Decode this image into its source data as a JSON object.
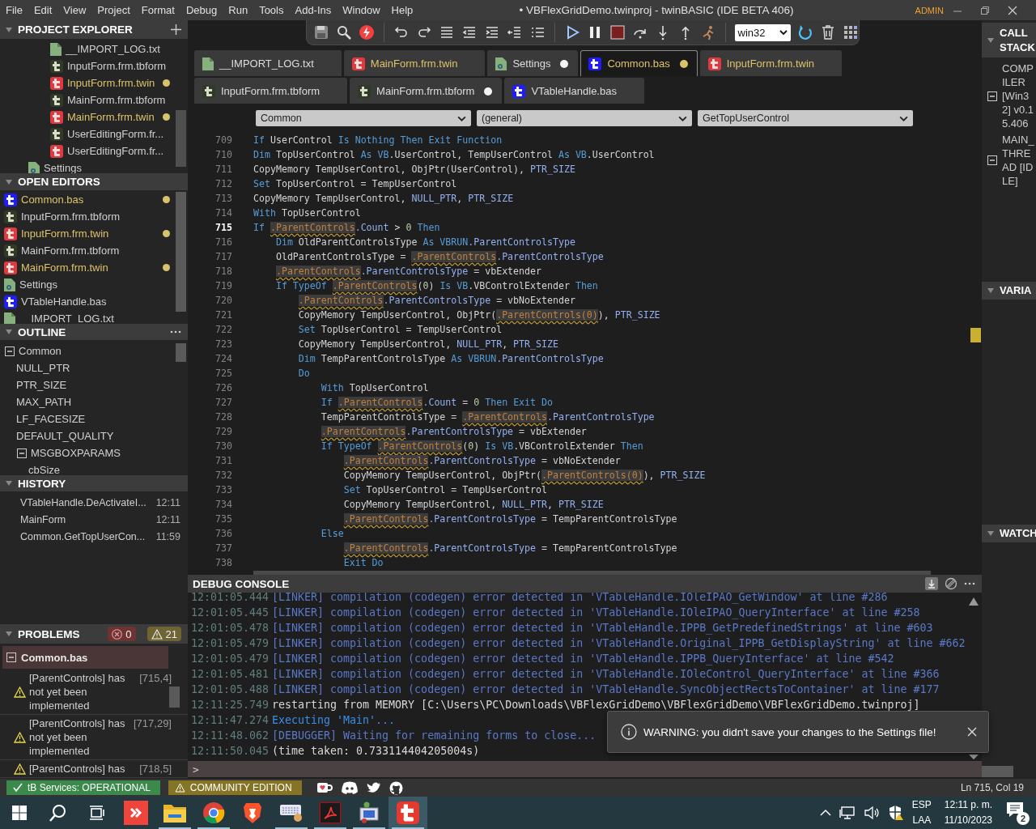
{
  "title_bar": {
    "menus": [
      "File",
      "Edit",
      "View",
      "Project",
      "Format",
      "Debug",
      "Run",
      "Tools",
      "Add-Ins",
      "Window",
      "Help"
    ],
    "title": "• VBFlexGridDemo.twinproj - twinBASIC (IDE BETA 406)",
    "user": "ADMIN"
  },
  "project_explorer": {
    "title": "PROJECT EXPLORER",
    "items": [
      {
        "kind": "group",
        "children": [
          {
            "kind": "txt",
            "label": "__IMPORT_LOG.txt",
            "warning": false,
            "unsaved": false
          },
          {
            "kind": "tbform",
            "label": "InputForm.frm.tbform",
            "warning": false,
            "unsaved": false
          },
          {
            "kind": "twin",
            "label": "InputForm.frm.twin",
            "warning": true,
            "unsaved": true
          },
          {
            "kind": "tbform",
            "label": "MainForm.frm.tbform",
            "warning": false,
            "unsaved": false
          },
          {
            "kind": "twin",
            "label": "MainForm.frm.twin",
            "warning": true,
            "unsaved": true
          },
          {
            "kind": "tbform",
            "label": "UserEditingForm.fr...",
            "warning": false,
            "unsaved": false
          },
          {
            "kind": "twin",
            "label": "UserEditingForm.fr...",
            "warning": false,
            "unsaved": false
          }
        ]
      },
      {
        "kind": "settings",
        "label": "Settings",
        "warning": false,
        "unsaved": false
      }
    ]
  },
  "open_editors": {
    "title": "OPEN EDITORS",
    "items": [
      {
        "kind": "bas",
        "label": "Common.bas",
        "warning": true,
        "unsaved": true
      },
      {
        "kind": "tbform",
        "label": "InputForm.frm.tbform",
        "warning": false,
        "unsaved": false
      },
      {
        "kind": "twin",
        "label": "InputForm.frm.twin",
        "warning": true,
        "unsaved": true
      },
      {
        "kind": "tbform",
        "label": "MainForm.frm.tbform",
        "warning": false,
        "unsaved": false
      },
      {
        "kind": "twin",
        "label": "MainForm.frm.twin",
        "warning": true,
        "unsaved": true
      },
      {
        "kind": "settings",
        "label": "Settings",
        "warning": false,
        "unsaved": false
      },
      {
        "kind": "bas",
        "label": "VTableHandle.bas",
        "warning": false,
        "unsaved": false
      },
      {
        "kind": "txt",
        "label": "__IMPORT_LOG.txt",
        "warning": false,
        "unsaved": false
      }
    ]
  },
  "outline": {
    "title": "OUTLINE",
    "items": [
      {
        "label": "Common",
        "expanded": true,
        "children": [
          {
            "label": "NULL_PTR"
          },
          {
            "label": "PTR_SIZE"
          },
          {
            "label": "MAX_PATH"
          },
          {
            "label": "LF_FACESIZE"
          },
          {
            "label": "DEFAULT_QUALITY"
          },
          {
            "label": "MSGBOXPARAMS",
            "expanded": true,
            "children": [
              {
                "label": "cbSize"
              }
            ]
          }
        ]
      }
    ]
  },
  "history": {
    "title": "HISTORY",
    "items": [
      {
        "label": "VTableHandle.DeActivateI...",
        "time": "12:11"
      },
      {
        "label": "MainForm",
        "time": "12:11"
      },
      {
        "label": "Common.GetTopUserCon...",
        "time": "11:59"
      }
    ]
  },
  "problems": {
    "title": "PROBLEMS",
    "errors": "0",
    "warnings": "21",
    "groups": [
      {
        "file": "Common.bas",
        "expanded": true,
        "selected": true,
        "items": [
          {
            "message": "[ParentControls] has not yet been implemented",
            "location": "[715,4]"
          },
          {
            "message": "[ParentControls] has not yet been implemented",
            "location": "[717,29]"
          },
          {
            "message": "[ParentControls] has",
            "location": "[718,5]"
          }
        ]
      }
    ]
  },
  "toolbar": {
    "platform": "win32"
  },
  "tab_rows": [
    {
      "tabs": [
        {
          "kind": "txt",
          "label": "__IMPORT_LOG.txt",
          "warning": false,
          "unsaved": false,
          "selected": false
        },
        {
          "kind": "twin",
          "label": "MainForm.frm.twin",
          "warning": true,
          "unsaved": false,
          "selected": false
        },
        {
          "kind": "settings",
          "label": "Settings",
          "warning": false,
          "unsaved": true,
          "selected": false
        },
        {
          "kind": "bas",
          "label": "Common.bas",
          "warning": true,
          "unsaved": true,
          "selected": true
        },
        {
          "kind": "twin",
          "label": "InputForm.frm.twin",
          "warning": true,
          "unsaved": false,
          "selected": false
        }
      ]
    },
    {
      "tabs": [
        {
          "kind": "tbform",
          "label": "InputForm.frm.tbform",
          "warning": false,
          "unsaved": false,
          "selected": false
        },
        {
          "kind": "tbform",
          "label": "MainForm.frm.tbform",
          "warning": false,
          "unsaved": true,
          "selected": false
        },
        {
          "kind": "bas",
          "label": "VTableHandle.bas",
          "warning": false,
          "unsaved": false,
          "selected": false
        }
      ]
    }
  ],
  "code_nav": [
    {
      "value": "Common"
    },
    {
      "value": "(general)"
    },
    {
      "value": "GetTopUserControl"
    }
  ],
  "editor": {
    "lines": [
      {
        "number": "709",
        "current": false,
        "tokens": [
          {
            "kind": "kw",
            "text": "If "
          },
          {
            "kind": "id",
            "text": "UserControl "
          },
          {
            "kind": "kw",
            "text": "Is Nothing Then Exit Function"
          }
        ]
      },
      {
        "number": "710",
        "current": false,
        "tokens": [
          {
            "kind": "kw",
            "text": "Dim "
          },
          {
            "kind": "id",
            "text": "TopUserControl "
          },
          {
            "kind": "kw",
            "text": "As VB"
          },
          {
            "kind": "id",
            "text": ".UserControl, TempUserControl "
          },
          {
            "kind": "kw",
            "text": "As VB"
          },
          {
            "kind": "id",
            "text": ".UserControl"
          }
        ]
      },
      {
        "number": "711",
        "current": false,
        "tokens": [
          {
            "kind": "id",
            "text": "CopyMemory TempUserControl, ObjPtr(UserControl), "
          },
          {
            "kind": "prop",
            "text": "PTR_SIZE"
          }
        ]
      },
      {
        "number": "712",
        "current": false,
        "tokens": [
          {
            "kind": "kw",
            "text": "Set "
          },
          {
            "kind": "id",
            "text": "TopUserControl = TempUserControl"
          }
        ]
      },
      {
        "number": "713",
        "current": false,
        "tokens": [
          {
            "kind": "id",
            "text": "CopyMemory TempUserControl, "
          },
          {
            "kind": "prop",
            "text": "NULL_PTR"
          },
          {
            "kind": "id",
            "text": ", "
          },
          {
            "kind": "prop",
            "text": "PTR_SIZE"
          }
        ]
      },
      {
        "number": "714",
        "current": false,
        "tokens": [
          {
            "kind": "kw",
            "text": "With "
          },
          {
            "kind": "id",
            "text": "TopUserControl"
          }
        ]
      },
      {
        "number": "715",
        "current": true,
        "tokens": [
          {
            "kind": "kw",
            "text": "If "
          },
          {
            "kind": "warn",
            "text": ".ParentControls"
          },
          {
            "kind": "prop",
            "text": ".Count"
          },
          {
            "kind": "id",
            "text": " > "
          },
          {
            "kind": "num",
            "text": "0"
          },
          {
            "kind": "kw",
            "text": " Then"
          }
        ]
      },
      {
        "number": "716",
        "current": false,
        "tokens": [
          {
            "kind": "kw",
            "text": "    Dim "
          },
          {
            "kind": "id",
            "text": "OldParentControlsType "
          },
          {
            "kind": "kw",
            "text": "As VBRUN"
          },
          {
            "kind": "prop",
            "text": ".ParentControlsType"
          }
        ]
      },
      {
        "number": "717",
        "current": false,
        "tokens": [
          {
            "kind": "id",
            "text": "    OldParentControlsType = "
          },
          {
            "kind": "warn",
            "text": ".ParentControls"
          },
          {
            "kind": "prop",
            "text": ".ParentControlsType"
          }
        ]
      },
      {
        "number": "718",
        "current": false,
        "tokens": [
          {
            "kind": "warn",
            "text": "    .ParentControls"
          },
          {
            "kind": "prop",
            "text": ".ParentControlsType"
          },
          {
            "kind": "id",
            "text": " = vbExtender"
          }
        ]
      },
      {
        "number": "719",
        "current": false,
        "tokens": [
          {
            "kind": "kw",
            "text": "    If TypeOf "
          },
          {
            "kind": "warn",
            "text": ".ParentControls"
          },
          {
            "kind": "id",
            "text": "("
          },
          {
            "kind": "num",
            "text": "0"
          },
          {
            "kind": "id",
            "text": ") "
          },
          {
            "kind": "kw",
            "text": "Is VB"
          },
          {
            "kind": "id",
            "text": ".VBControlExtender "
          },
          {
            "kind": "kw",
            "text": "Then"
          }
        ]
      },
      {
        "number": "720",
        "current": false,
        "tokens": [
          {
            "kind": "warn",
            "text": "        .ParentControls"
          },
          {
            "kind": "prop",
            "text": ".ParentControlsType"
          },
          {
            "kind": "id",
            "text": " = vbNoExtender"
          }
        ]
      },
      {
        "number": "721",
        "current": false,
        "tokens": [
          {
            "kind": "id",
            "text": "        CopyMemory TempUserControl, ObjPtr("
          },
          {
            "kind": "warn",
            "text": ".ParentControls(0)"
          },
          {
            "kind": "id",
            "text": "), "
          },
          {
            "kind": "prop",
            "text": "PTR_SIZE"
          }
        ]
      },
      {
        "number": "722",
        "current": false,
        "tokens": [
          {
            "kind": "kw",
            "text": "        Set "
          },
          {
            "kind": "id",
            "text": "TopUserControl = TempUserControl"
          }
        ]
      },
      {
        "number": "723",
        "current": false,
        "tokens": [
          {
            "kind": "id",
            "text": "        CopyMemory TempUserControl, "
          },
          {
            "kind": "prop",
            "text": "NULL_PTR"
          },
          {
            "kind": "id",
            "text": ", "
          },
          {
            "kind": "prop",
            "text": "PTR_SIZE"
          }
        ]
      },
      {
        "number": "724",
        "current": false,
        "tokens": [
          {
            "kind": "kw",
            "text": "        Dim "
          },
          {
            "kind": "id",
            "text": "TempParentControlsType "
          },
          {
            "kind": "kw",
            "text": "As VBRUN"
          },
          {
            "kind": "prop",
            "text": ".ParentControlsType"
          }
        ]
      },
      {
        "number": "725",
        "current": false,
        "tokens": [
          {
            "kind": "kw",
            "text": "        Do"
          }
        ]
      },
      {
        "number": "726",
        "current": false,
        "tokens": [
          {
            "kind": "kw",
            "text": "            With "
          },
          {
            "kind": "id",
            "text": "TopUserControl"
          }
        ]
      },
      {
        "number": "727",
        "current": false,
        "tokens": [
          {
            "kind": "kw",
            "text": "            If "
          },
          {
            "kind": "warn",
            "text": ".ParentControls"
          },
          {
            "kind": "prop",
            "text": ".Count"
          },
          {
            "kind": "id",
            "text": " = "
          },
          {
            "kind": "num",
            "text": "0"
          },
          {
            "kind": "kw",
            "text": " Then Exit Do"
          }
        ]
      },
      {
        "number": "728",
        "current": false,
        "tokens": [
          {
            "kind": "id",
            "text": "            TempParentControlsType = "
          },
          {
            "kind": "warn",
            "text": ".ParentControls"
          },
          {
            "kind": "prop",
            "text": ".ParentControlsType"
          }
        ]
      },
      {
        "number": "729",
        "current": false,
        "tokens": [
          {
            "kind": "warn",
            "text": "            .ParentControls"
          },
          {
            "kind": "prop",
            "text": ".ParentControlsType"
          },
          {
            "kind": "id",
            "text": " = vbExtender"
          }
        ]
      },
      {
        "number": "730",
        "current": false,
        "tokens": [
          {
            "kind": "kw",
            "text": "            If TypeOf "
          },
          {
            "kind": "warn",
            "text": ".ParentControls"
          },
          {
            "kind": "id",
            "text": "("
          },
          {
            "kind": "num",
            "text": "0"
          },
          {
            "kind": "id",
            "text": ") "
          },
          {
            "kind": "kw",
            "text": "Is VB"
          },
          {
            "kind": "id",
            "text": ".VBControlExtender "
          },
          {
            "kind": "kw",
            "text": "Then"
          }
        ]
      },
      {
        "number": "731",
        "current": false,
        "tokens": [
          {
            "kind": "warn",
            "text": "                .ParentControls"
          },
          {
            "kind": "prop",
            "text": ".ParentControlsType"
          },
          {
            "kind": "id",
            "text": " = vbNoExtender"
          }
        ]
      },
      {
        "number": "732",
        "current": false,
        "tokens": [
          {
            "kind": "id",
            "text": "                CopyMemory TempUserControl, ObjPtr("
          },
          {
            "kind": "warn",
            "text": ".ParentControls(0)"
          },
          {
            "kind": "id",
            "text": "), "
          },
          {
            "kind": "prop",
            "text": "PTR_SIZE"
          }
        ]
      },
      {
        "number": "733",
        "current": false,
        "tokens": [
          {
            "kind": "kw",
            "text": "                Set "
          },
          {
            "kind": "id",
            "text": "TopUserControl = TempUserControl"
          }
        ]
      },
      {
        "number": "734",
        "current": false,
        "tokens": [
          {
            "kind": "id",
            "text": "                CopyMemory TempUserControl, "
          },
          {
            "kind": "prop",
            "text": "NULL_PTR"
          },
          {
            "kind": "id",
            "text": ", "
          },
          {
            "kind": "prop",
            "text": "PTR_SIZE"
          }
        ]
      },
      {
        "number": "735",
        "current": false,
        "tokens": [
          {
            "kind": "warn",
            "text": "                .ParentControls"
          },
          {
            "kind": "prop",
            "text": ".ParentControlsType"
          },
          {
            "kind": "id",
            "text": " = TempParentControlsType"
          }
        ]
      },
      {
        "number": "736",
        "current": false,
        "tokens": [
          {
            "kind": "kw",
            "text": "            Else"
          }
        ]
      },
      {
        "number": "737",
        "current": false,
        "tokens": [
          {
            "kind": "warn",
            "text": "                .ParentControls"
          },
          {
            "kind": "prop",
            "text": ".ParentControlsType"
          },
          {
            "kind": "id",
            "text": " = TempParentControlsType"
          }
        ]
      },
      {
        "number": "738",
        "current": false,
        "tokens": [
          {
            "kind": "kw",
            "text": "                Exit Do"
          }
        ]
      }
    ]
  },
  "debug_console": {
    "title": "DEBUG CONSOLE",
    "prompt": ">",
    "lines": [
      {
        "time": "12:01:05.444",
        "kind": "linker",
        "text": "[LINKER] compilation (codegen) error detected in 'VTableHandle.IOleIPAO_GetWindow' at line #286"
      },
      {
        "time": "12:01:05.445",
        "kind": "linker",
        "text": "[LINKER] compilation (codegen) error detected in 'VTableHandle.IOleIPAO_QueryInterface' at line #258"
      },
      {
        "time": "12:01:05.478",
        "kind": "linker",
        "text": "[LINKER] compilation (codegen) error detected in 'VTableHandle.IPPB_GetPredefinedStrings' at line #603"
      },
      {
        "time": "12:01:05.479",
        "kind": "linker",
        "text": "[LINKER] compilation (codegen) error detected in 'VTableHandle.Original_IPPB_GetDisplayString' at line #662"
      },
      {
        "time": "12:01:05.479",
        "kind": "linker",
        "text": "[LINKER] compilation (codegen) error detected in 'VTableHandle.IPPB_QueryInterface' at line #542"
      },
      {
        "time": "12:01:05.481",
        "kind": "linker",
        "text": "[LINKER] compilation (codegen) error detected in 'VTableHandle.IOleControl_QueryInterface' at line #366"
      },
      {
        "time": "12:01:05.488",
        "kind": "linker",
        "text": "[LINKER] compilation (codegen) error detected in 'VTableHandle.SyncObjectRectsToContainer' at line #177"
      },
      {
        "time": "12:11:25.749",
        "kind": "plain",
        "text": "restarting from MEMORY [C:\\Users\\PC\\Downloads\\VBFlexGridDemo\\VBFlexGridDemo\\VBFlexGridDemo.twinproj]"
      },
      {
        "time": "12:11:47.274",
        "kind": "exec",
        "text": "Executing 'Main'..."
      },
      {
        "time": "12:11:48.062",
        "kind": "linker",
        "text": "[DEBUGGER] Waiting for remaining forms to close..."
      },
      {
        "time": "12:11:50.045",
        "kind": "plain",
        "text": "(time taken: 0.733114404205004s)"
      }
    ]
  },
  "toast": {
    "message": "WARNING: you didn't save your changes to the Settings file!"
  },
  "call_stack": {
    "title": "CALL STACK",
    "threads": [
      {
        "label": "COMPILER [Win32] v0.15.406",
        "expanded": true
      },
      {
        "label": "MAIN_THREAD [IDLE]",
        "expanded": true
      }
    ]
  },
  "variables": {
    "title": "VARIA"
  },
  "watch": {
    "title": "WATCH"
  },
  "status_bar": {
    "services": "tB Services: OPERATIONAL",
    "edition": "COMMUNITY EDITION",
    "position": "Ln 715, Col 19"
  },
  "taskbar": {
    "buttons": [
      {
        "kind": "start"
      },
      {
        "kind": "search"
      },
      {
        "kind": "task_view"
      }
    ],
    "apps": [
      {
        "kind": "remote",
        "running": false,
        "active": false
      },
      {
        "kind": "folder",
        "running": true,
        "active": false
      },
      {
        "kind": "browser_round",
        "running": true,
        "active": false
      },
      {
        "kind": "browser_shield",
        "running": false,
        "active": false
      },
      {
        "kind": "keyboard",
        "running": true,
        "active": false
      },
      {
        "kind": "pdf",
        "running": true,
        "active": false
      },
      {
        "kind": "setup",
        "running": true,
        "active": false
      },
      {
        "kind": "t_app",
        "running": true,
        "active": true
      }
    ],
    "language": "ESP",
    "layout": "LAA",
    "time": "12:11 p. m.",
    "date": "11/10/2023",
    "notifications": "2"
  }
}
